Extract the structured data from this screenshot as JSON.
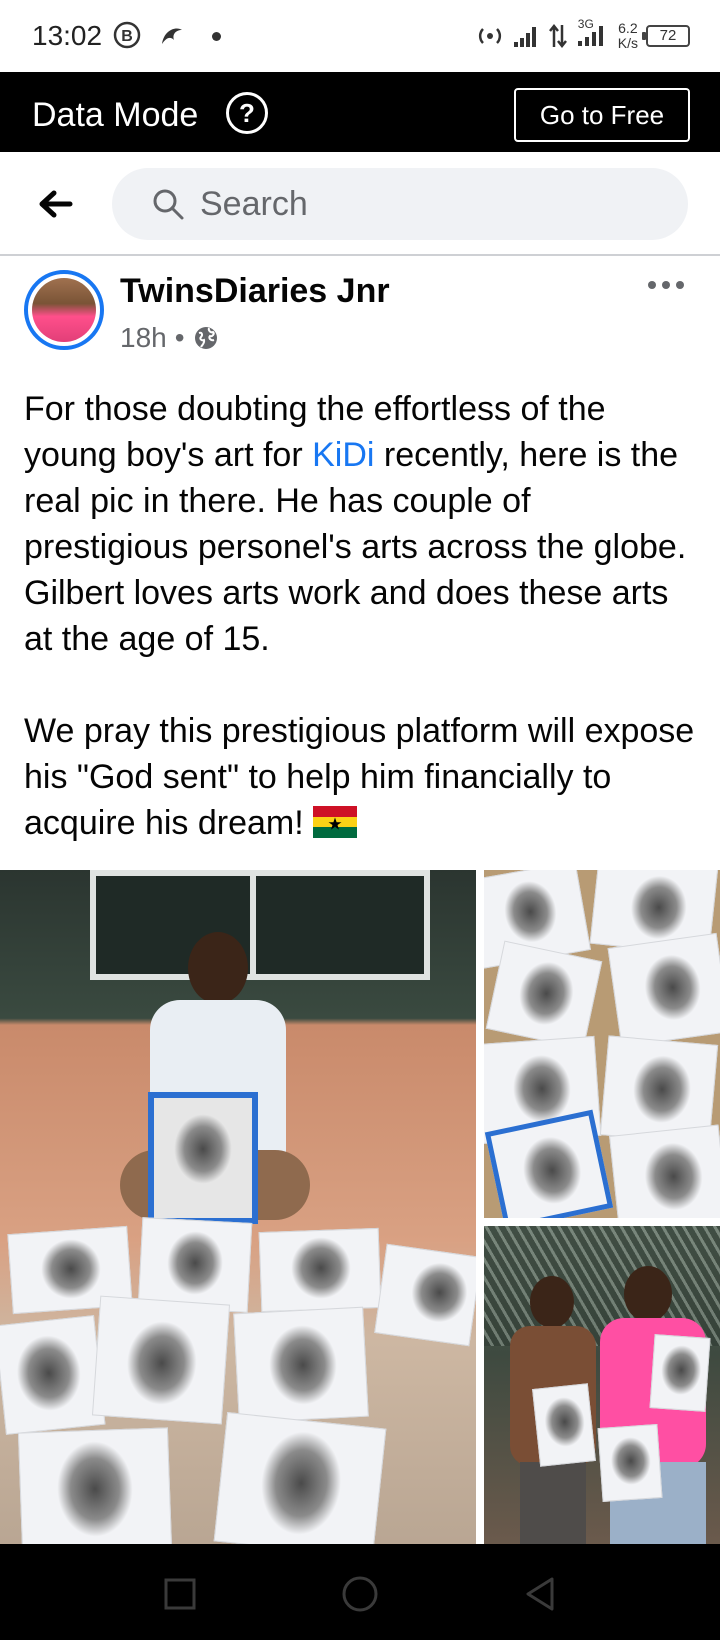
{
  "status_bar": {
    "time": "13:02",
    "net_speed_value": "6.2",
    "net_speed_unit": "K/s",
    "network_type": "3G",
    "battery": "72"
  },
  "data_bar": {
    "title": "Data Mode",
    "help_glyph": "?",
    "go_free_label": "Go to Free"
  },
  "search": {
    "placeholder": "Search"
  },
  "post": {
    "author": "TwinsDiaries Jnr",
    "time": "18h",
    "separator": "•",
    "paragraph1_before": "For those doubting the effortless of the young boy's art for ",
    "mention": "KiDi",
    "paragraph1_after": " recently, here is the real pic in there. He has couple of prestigious personel's arts across the globe. Gilbert loves arts work and does these arts at the age of 15.",
    "paragraph2": "We pray this prestigious platform will expose his \"God sent\" to help him financially to acquire his dream!"
  },
  "colors": {
    "accent": "#1877f2",
    "secondary_text": "#65676b",
    "search_bg": "#f0f2f5"
  },
  "icons": [
    "back-arrow-icon",
    "search-icon",
    "globe-icon",
    "more-icon",
    "help-icon",
    "ghana-flag-icon"
  ]
}
